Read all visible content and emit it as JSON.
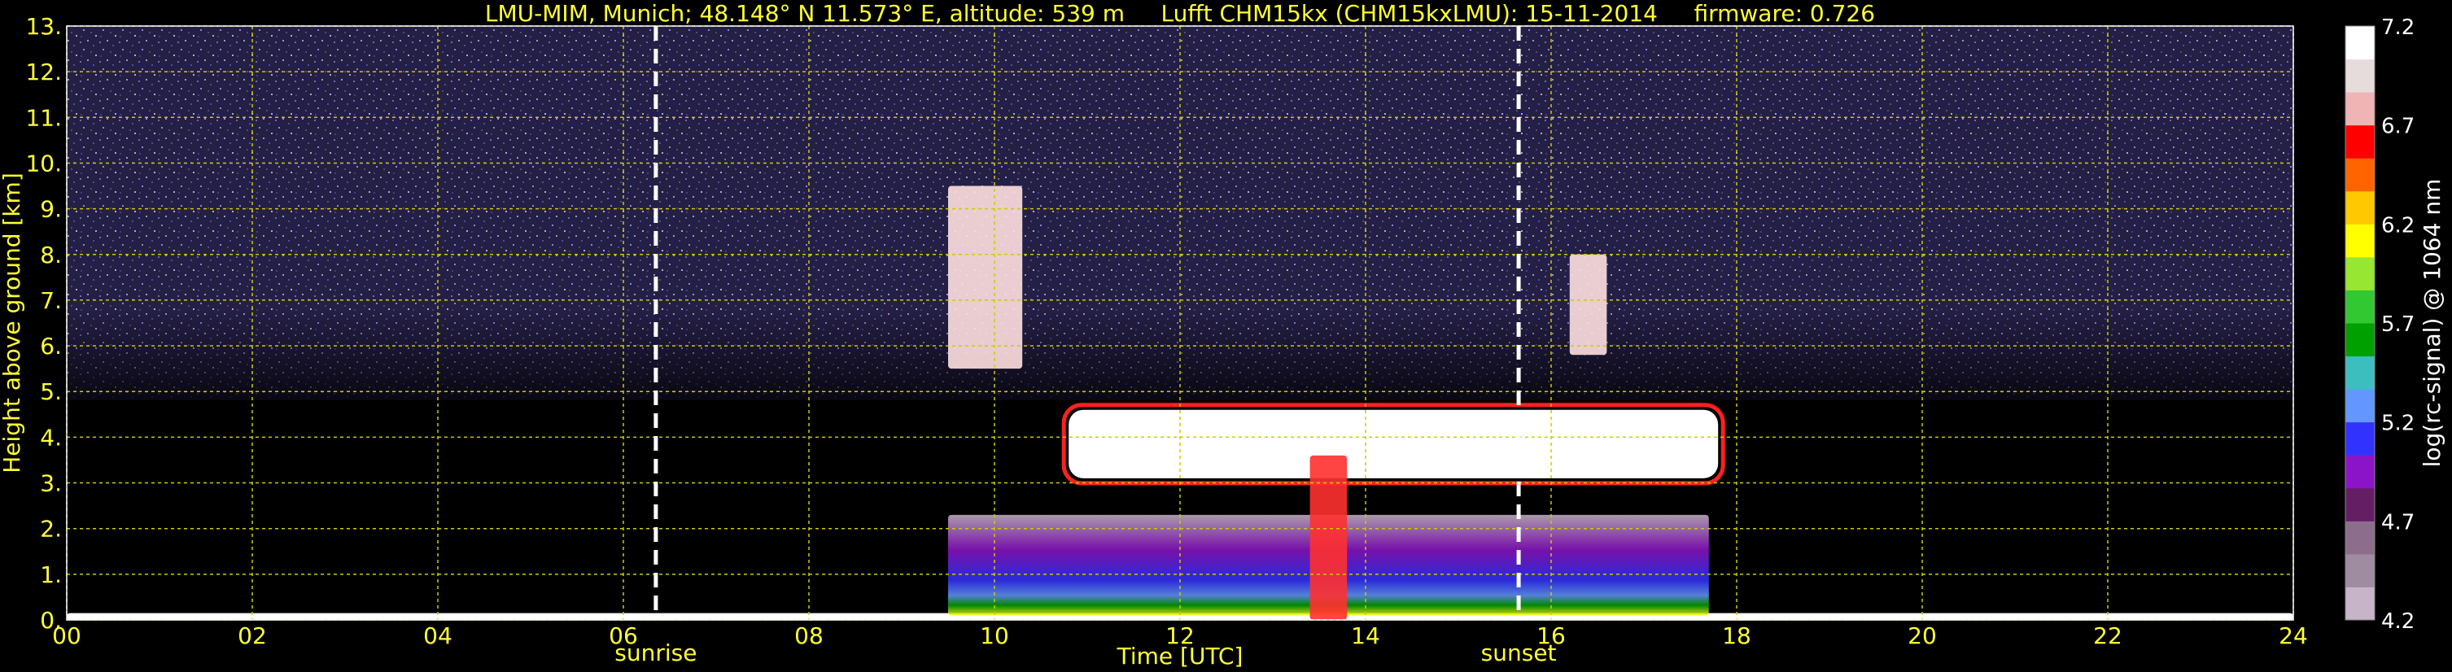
{
  "title": "LMU-MIM, Munich; 48.148° N 11.573° E, altitude: 539 m     Lufft CHM15kx (CHM15kxLMU): 15-11-2014     firmware: 0.726",
  "chart_data": {
    "type": "heatmap",
    "title": "LMU-MIM, Munich; 48.148° N 11.573° E, altitude: 539 m     Lufft CHM15kx (CHM15kxLMU): 15-11-2014     firmware: 0.726",
    "xlabel": "Time [UTC]",
    "ylabel": "Height above ground [km]",
    "xlim": [
      0,
      24
    ],
    "ylim": [
      0,
      13
    ],
    "x_ticks": [
      "00",
      "02",
      "04",
      "06",
      "08",
      "10",
      "12",
      "14",
      "16",
      "18",
      "20",
      "22",
      "24"
    ],
    "y_ticks": [
      "0.",
      "1.",
      "2.",
      "3.",
      "4.",
      "5.",
      "6.",
      "7.",
      "8.",
      "9.",
      "10.",
      "11.",
      "12.",
      "13."
    ],
    "grid": true,
    "grid_color": "#cccc00",
    "background_color": "#000000",
    "markers": [
      {
        "label": "sunrise",
        "x": 6.35
      },
      {
        "label": "sunset",
        "x": 15.65
      }
    ],
    "colorbar": {
      "label": "log(rc-signal) @ 1064 nm",
      "ticks": [
        "4.2",
        "4.7",
        "5.2",
        "5.7",
        "6.2",
        "6.7",
        "7.2"
      ],
      "range": [
        4.2,
        7.2
      ],
      "colors": [
        "#c8b4c8",
        "#a08ca0",
        "#8c6e8c",
        "#641e64",
        "#8c14c8",
        "#3232ff",
        "#6496ff",
        "#3cbebe",
        "#00a000",
        "#32c832",
        "#96e632",
        "#ffff00",
        "#ffc800",
        "#ff6400",
        "#ff0000",
        "#f0b4b4",
        "#e6dcdc",
        "#ffffff"
      ]
    },
    "features": [
      {
        "name": "surface layer",
        "x_range": [
          0,
          24
        ],
        "height_range": [
          0,
          0.15
        ]
      },
      {
        "name": "boundary layer aerosol",
        "x_range": [
          9.5,
          17.7
        ],
        "height_range": [
          0.1,
          2.3
        ]
      },
      {
        "name": "cloud layer",
        "x_range": [
          10.8,
          17.8
        ],
        "height_range": [
          3.1,
          4.6
        ]
      },
      {
        "name": "cirrus",
        "x_range": [
          9.5,
          10.3
        ],
        "height_range": [
          5.5,
          9.5
        ]
      },
      {
        "name": "cirrus",
        "x_range": [
          16.2,
          16.6
        ],
        "height_range": [
          5.8,
          8.0
        ]
      },
      {
        "name": "precipitation",
        "x_range": [
          13.4,
          13.8
        ],
        "height_range": [
          0,
          3.6
        ]
      }
    ]
  },
  "axis_text": {
    "xlabel": "Time [UTC]",
    "ylabel": "Height above ground [km]",
    "sunrise": "sunrise",
    "sunset": "sunset",
    "colorbar_label": "log(rc-signal) @ 1064 nm"
  }
}
